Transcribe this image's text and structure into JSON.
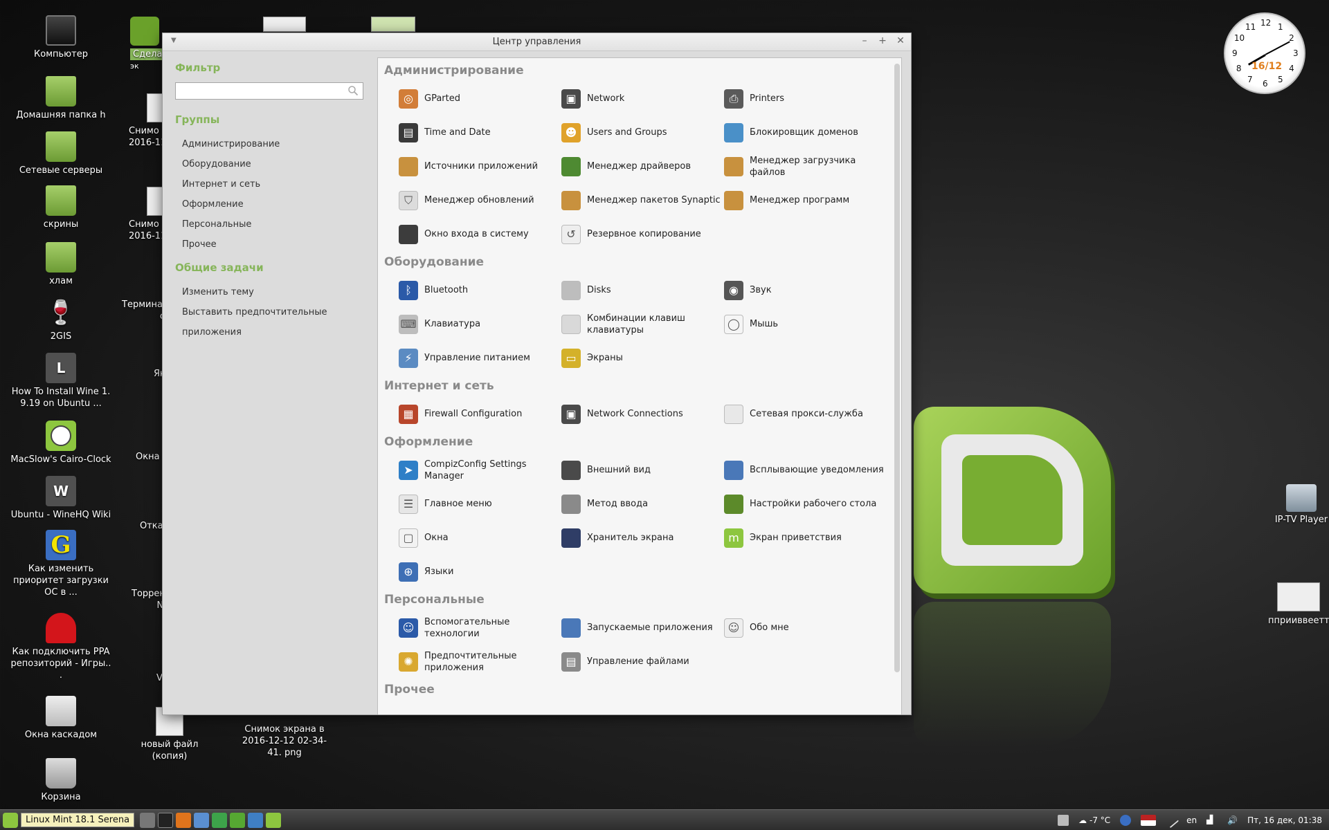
{
  "desktop_icons": [
    {
      "label": "Компьютер",
      "icon": "computer-icon"
    },
    {
      "label": "Домашняя папка h",
      "icon": "home-folder-icon"
    },
    {
      "label": "Сетевые серверы",
      "icon": "network-servers-icon"
    },
    {
      "label": "скрины",
      "icon": "folder-icon"
    },
    {
      "label": "хлам",
      "icon": "folder-icon"
    },
    {
      "label": "2GIS",
      "icon": "wine-glass-icon"
    },
    {
      "label": "How To Install Wine 1. 9.19 on Ubuntu ...",
      "icon": "letter-l-icon",
      "letter": "L"
    },
    {
      "label": "MacSlow's Cairo-Clock",
      "icon": "clock-icon"
    },
    {
      "label": "Ubuntu - WineHQ Wiki",
      "icon": "letter-w-icon",
      "letter": "W"
    },
    {
      "label": "Как изменить приоритет загрузки ОС в ...",
      "icon": "grub-g-icon",
      "letter": "G"
    },
    {
      "label": "Как подключить PPA репозиторий - Игры.. .",
      "icon": "pacman-ghost-icon"
    },
    {
      "label": "Окна каскадом",
      "icon": "cascade-windows-icon"
    },
    {
      "label": "Корзина",
      "icon": "trash-icon"
    }
  ],
  "desktop_partial": [
    {
      "label": "Сдела",
      "sub": "эк"
    },
    {
      "label": "Снимо",
      "sub": "2016-11-"
    },
    {
      "label": "Снимо",
      "sub": "2016-11-"
    },
    {
      "label": "Термина",
      "sub": "co"
    },
    {
      "label": "Як"
    },
    {
      "label": "Окна н"
    },
    {
      "label": "Откат"
    },
    {
      "label": "Торрен",
      "sub": "NN"
    },
    {
      "label": "V"
    },
    {
      "label": "новый файл (копия)"
    },
    {
      "label": "Снимок экрана в 2016-12-12 02-34-41. png"
    }
  ],
  "right_icons": [
    {
      "label": "IP-TV Player"
    },
    {
      "label": "пприиввеетт.р"
    }
  ],
  "clock": {
    "numbers": [
      "12",
      "1",
      "2",
      "3",
      "4",
      "5",
      "6",
      "7",
      "8",
      "9",
      "10",
      "11"
    ],
    "date": "16/12"
  },
  "window": {
    "title": "Центр управления"
  },
  "sidebar": {
    "filter_heading": "Фильтр",
    "search_value": "",
    "groups_heading": "Группы",
    "groups": [
      "Администрирование",
      "Оборудование",
      "Интернет и сеть",
      "Оформление",
      "Персональные",
      "Прочее"
    ],
    "tasks_heading": "Общие задачи",
    "tasks": [
      "Изменить тему",
      "Выставить предпочтительные приложения"
    ]
  },
  "categories": [
    {
      "title": "Администрирование",
      "items": [
        {
          "label": "GParted",
          "icon": "gparted-icon",
          "color": "#d27d38"
        },
        {
          "label": "Network",
          "icon": "network-icon",
          "color": "#4a4a4a"
        },
        {
          "label": "Printers",
          "icon": "printer-icon",
          "color": "#5a5a5a"
        },
        {
          "label": "Time and Date",
          "icon": "calendar-icon",
          "color": "#3a3a3a"
        },
        {
          "label": "Users and Groups",
          "icon": "users-icon",
          "color": "#e0a22a"
        },
        {
          "label": "Блокировщик доменов",
          "icon": "domain-blocker-icon",
          "color": "#4a90c8"
        },
        {
          "label": "Источники приложений",
          "icon": "software-sources-icon",
          "color": "#c8913e"
        },
        {
          "label": "Менеджер драйверов",
          "icon": "driver-manager-icon",
          "color": "#4e8a32"
        },
        {
          "label": "Менеджер загрузчика файлов",
          "icon": "download-manager-icon",
          "color": "#c8913e"
        },
        {
          "label": "Менеджер обновлений",
          "icon": "shield-icon",
          "color": "#dcdcdc"
        },
        {
          "label": "Менеджер пакетов Synaptic",
          "icon": "package-icon",
          "color": "#c8913e"
        },
        {
          "label": "Менеджер программ",
          "icon": "software-manager-icon",
          "color": "#c8913e"
        },
        {
          "label": "Окно входа в систему",
          "icon": "login-window-icon",
          "color": "#3c3c3c"
        },
        {
          "label": "Резервное копирование",
          "icon": "backup-icon",
          "color": "#eeeeee"
        }
      ]
    },
    {
      "title": "Оборудование",
      "items": [
        {
          "label": "Bluetooth",
          "icon": "bluetooth-icon",
          "color": "#2b5aa8"
        },
        {
          "label": "Disks",
          "icon": "disks-icon",
          "color": "#bdbdbd"
        },
        {
          "label": "Звук",
          "icon": "speaker-icon",
          "color": "#555555"
        },
        {
          "label": "Клавиатура",
          "icon": "keyboard-icon",
          "color": "#bdbdbd"
        },
        {
          "label": "Комбинации клавиш клавиатуры",
          "icon": "keyboard-shortcuts-icon",
          "color": "#d9d9d9"
        },
        {
          "label": "Мышь",
          "icon": "mouse-icon",
          "color": "#f5f5f5"
        },
        {
          "label": "Управление питанием",
          "icon": "power-icon",
          "color": "#5b8bc2"
        },
        {
          "label": "Экраны",
          "icon": "display-icon",
          "color": "#d4b12a"
        }
      ]
    },
    {
      "title": "Интернет и сеть",
      "items": [
        {
          "label": "Firewall Configuration",
          "icon": "firewall-icon",
          "color": "#b8462b"
        },
        {
          "label": "Network Connections",
          "icon": "network-connections-icon",
          "color": "#4a4a4a"
        },
        {
          "label": "Сетевая прокси-служба",
          "icon": "proxy-icon",
          "color": "#e8e8e8"
        }
      ]
    },
    {
      "title": "Оформление",
      "items": [
        {
          "label": "CompizConfig Settings Manager",
          "icon": "compiz-icon",
          "color": "#2e7fc7"
        },
        {
          "label": "Внешний вид",
          "icon": "appearance-icon",
          "color": "#4a4a4a"
        },
        {
          "label": "Всплывающие уведомления",
          "icon": "notifications-icon",
          "color": "#4a78b8"
        },
        {
          "label": "Главное меню",
          "icon": "main-menu-icon",
          "color": "#e6e6e6"
        },
        {
          "label": "Метод ввода",
          "icon": "input-method-icon",
          "color": "#8a8a8a"
        },
        {
          "label": "Настройки рабочего стола",
          "icon": "desktop-settings-icon",
          "color": "#5c8a2a"
        },
        {
          "label": "Окна",
          "icon": "windows-icon",
          "color": "#f2f2f2"
        },
        {
          "label": "Хранитель экрана",
          "icon": "screensaver-icon",
          "color": "#2f3d66"
        },
        {
          "label": "Экран приветствия",
          "icon": "welcome-screen-icon",
          "color": "#8dc63f"
        },
        {
          "label": "Языки",
          "icon": "languages-icon",
          "color": "#3e6fb5"
        }
      ]
    },
    {
      "title": "Персональные",
      "items": [
        {
          "label": "Вспомогательные технологии",
          "icon": "accessibility-icon",
          "color": "#2b5aa8"
        },
        {
          "label": "Запускаемые приложения",
          "icon": "startup-apps-icon",
          "color": "#4a78b8"
        },
        {
          "label": "Обо мне",
          "icon": "about-me-icon",
          "color": "#eeeeee"
        },
        {
          "label": "Предпочтительные приложения",
          "icon": "preferred-apps-icon",
          "color": "#d9a830"
        },
        {
          "label": "Управление файлами",
          "icon": "file-management-icon",
          "color": "#8a8a8a"
        }
      ]
    },
    {
      "title": "Прочее",
      "items": []
    }
  ],
  "taskbar": {
    "start_label": "Linux Mint 18.1 Serena",
    "weather": "-7 °C",
    "keyboard_layout": "en",
    "datetime": "Пт, 16 дек, 01:38"
  },
  "colors": {
    "accent": "#86b55a",
    "category_title": "#8a8a8a",
    "window_bg": "#dcdcdc",
    "content_bg": "#f6f6f6"
  }
}
